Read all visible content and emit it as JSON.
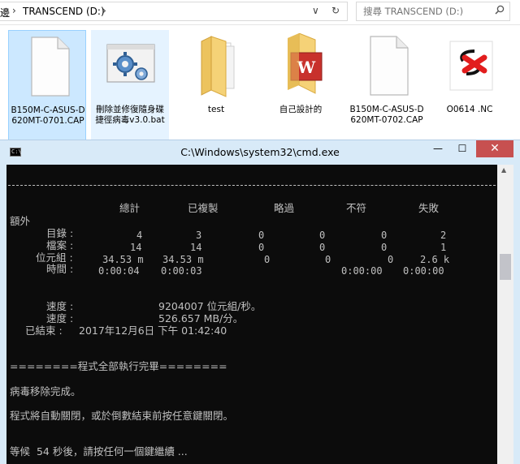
{
  "explorer": {
    "back_fragment": "邊",
    "path_sep": "›",
    "drive_label": "TRANSCEND (D:)",
    "path_chevron": "›",
    "dropdown_glyph": "∨",
    "refresh_glyph": "↻",
    "search_placeholder": "搜尋 TRANSCEND (D:)",
    "search_icon": "search-icon"
  },
  "files": [
    {
      "label": "B150M-C-ASUS-D620MT-0701.CAP",
      "icon": "blank-file-icon",
      "state": "selected"
    },
    {
      "label": "刪除並修復隨身碟捷徑病毒v3.0.bat",
      "icon": "gear-file-icon",
      "state": "hover"
    },
    {
      "label": "test",
      "icon": "folder-icon",
      "state": "normal"
    },
    {
      "label": "自己設計的",
      "icon": "folder-word-icon",
      "state": "normal"
    },
    {
      "label": "B150M-C-ASUS-D620MT-0702.CAP",
      "icon": "blank-file-icon",
      "state": "normal"
    },
    {
      "label": "O0614 .NC",
      "icon": "nc-file-icon",
      "state": "normal"
    }
  ],
  "cmd": {
    "title": "C:\\Windows\\system32\\cmd.exe",
    "sys_icon_text": "C:\\",
    "minimize_glyph": "—",
    "maximize_glyph": "☐",
    "close_glyph": "✕",
    "summary": {
      "headers": [
        "總計",
        "已複製",
        "略過",
        "不符",
        "失敗",
        "額外"
      ],
      "rows": [
        {
          "label": "目錄 :",
          "values": [
            "4",
            "3",
            "0",
            "0",
            "0",
            "2"
          ]
        },
        {
          "label": "檔案 :",
          "values": [
            "14",
            "14",
            "0",
            "0",
            "0",
            "1"
          ]
        },
        {
          "label": "位元組 :",
          "values": [
            "34.53 m",
            "34.53 m",
            "0",
            "0",
            "0",
            "2.6 k"
          ]
        },
        {
          "label": "時間 :",
          "values": [
            "0:00:04",
            "0:00:03",
            "",
            "",
            "0:00:00",
            "0:00:00"
          ]
        }
      ]
    },
    "speed1_label": "速度 :",
    "speed1_value": "9204007 位元組/秒。",
    "speed2_label": "速度 :",
    "speed2_value": "526.657 MB/分。",
    "ended_label": "已結束 :",
    "ended_value": "2017年12月6日 下午 01:42:40",
    "done_banner": "========程式全部執行完畢========",
    "virus_removed": "病毒移除完成。",
    "auto_close": "程式將自動關閉，或於倒數結束前按任意鍵關閉。",
    "countdown": "等候  54 秒後，請按任何一個鍵繼續 ..."
  },
  "colors": {
    "console_bg": "#0c0c0c",
    "console_text": "#c0c0c0",
    "titlebar_bg": "#d8eaf8",
    "close_button": "#c75050",
    "selection": "#cce8ff"
  }
}
